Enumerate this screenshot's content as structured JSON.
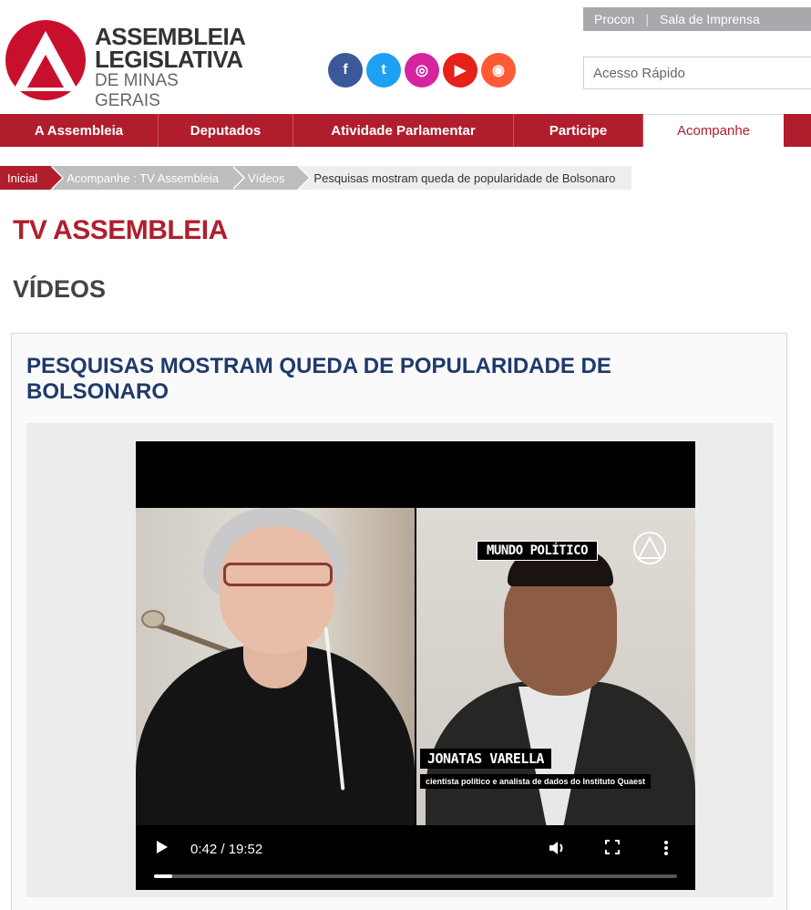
{
  "util": {
    "procon": "Procon",
    "separator": "|",
    "imprensa": "Sala de Imprensa"
  },
  "logo": {
    "line1": "ASSEMBLEIA",
    "line2": "LEGISLATIVA",
    "line3": "DE MINAS GERAIS"
  },
  "social": [
    {
      "icon": "facebook-icon",
      "glyph": "f",
      "color": "#3b5998"
    },
    {
      "icon": "twitter-icon",
      "glyph": "t",
      "color": "#1da1f2"
    },
    {
      "icon": "instagram-icon",
      "glyph": "◎",
      "color": "#d6249f"
    },
    {
      "icon": "youtube-icon",
      "glyph": "▶",
      "color": "#e62117"
    },
    {
      "icon": "soundcloud-icon",
      "glyph": "◉",
      "color": "#ff5a36"
    }
  ],
  "search": {
    "placeholder": "Acesso Rápido"
  },
  "nav": [
    {
      "label": "A Assembleia",
      "active": false
    },
    {
      "label": "Deputados",
      "active": false
    },
    {
      "label": "Atividade Parlamentar",
      "active": false
    },
    {
      "label": "Participe",
      "active": false
    },
    {
      "label": "Acompanhe",
      "active": true
    }
  ],
  "breadcrumb": {
    "home": "Inicial",
    "level1": "Acompanhe : TV Assembleia",
    "level2": "Vídeos",
    "current": "Pesquisas mostram queda de popularidade de Bolsonaro"
  },
  "page_title": "TV ASSEMBLEIA",
  "section_title": "VÍDEOS",
  "video": {
    "title": "PESQUISAS MOSTRAM QUEDA DE POPULARIDADE DE BOLSONARO",
    "program_badge": "MUNDO POLÍTICO",
    "guest_name": "JONATAS VARELLA",
    "guest_role": "cientista político e analista de dados do Instituto Quaest",
    "time_display": "0:42 / 19:52",
    "progress_fraction": 0.035,
    "colors": {
      "accent": "#b01e2e",
      "title": "#1f3a6b"
    }
  }
}
